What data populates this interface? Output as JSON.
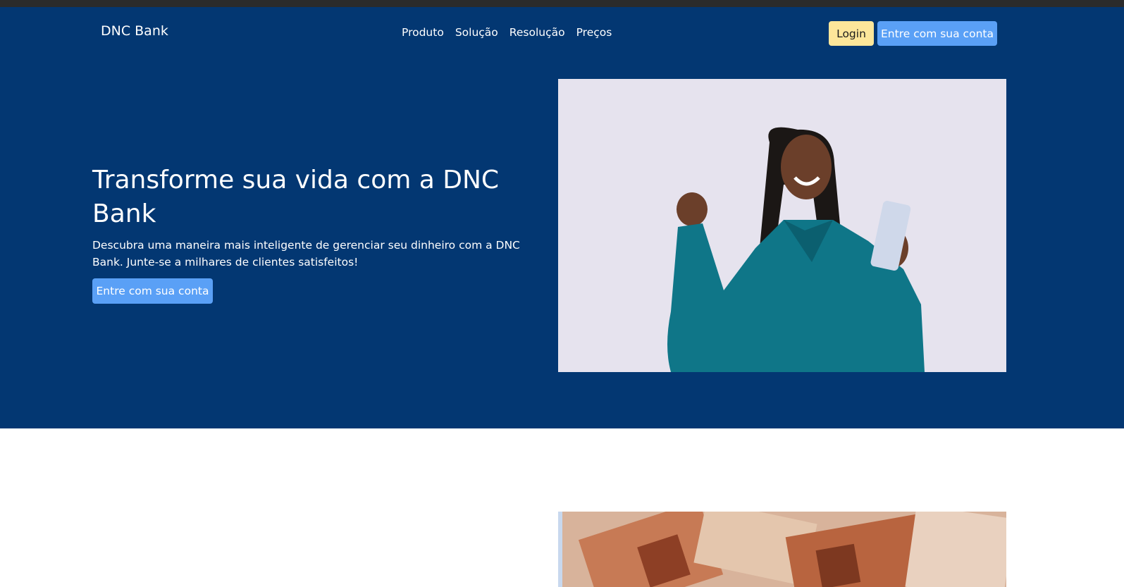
{
  "brand": "DNC Bank",
  "nav": {
    "links": [
      "Produto",
      "Solução",
      "Resolução",
      "Preços"
    ],
    "login_label": "Login",
    "signin_label": "Entre com sua conta"
  },
  "hero": {
    "title": "Transforme sua vida com a DNC Bank",
    "description": "Descubra uma maneira mais inteligente de gerenciar seu dinheiro com a DNC Bank. Junte-se a milhares de clientes satisfeitos!",
    "cta_label": "Entre com sua conta"
  },
  "colors": {
    "primary": "#033772",
    "accent_button": "#5aa0f6",
    "login_button": "#fde69a"
  }
}
